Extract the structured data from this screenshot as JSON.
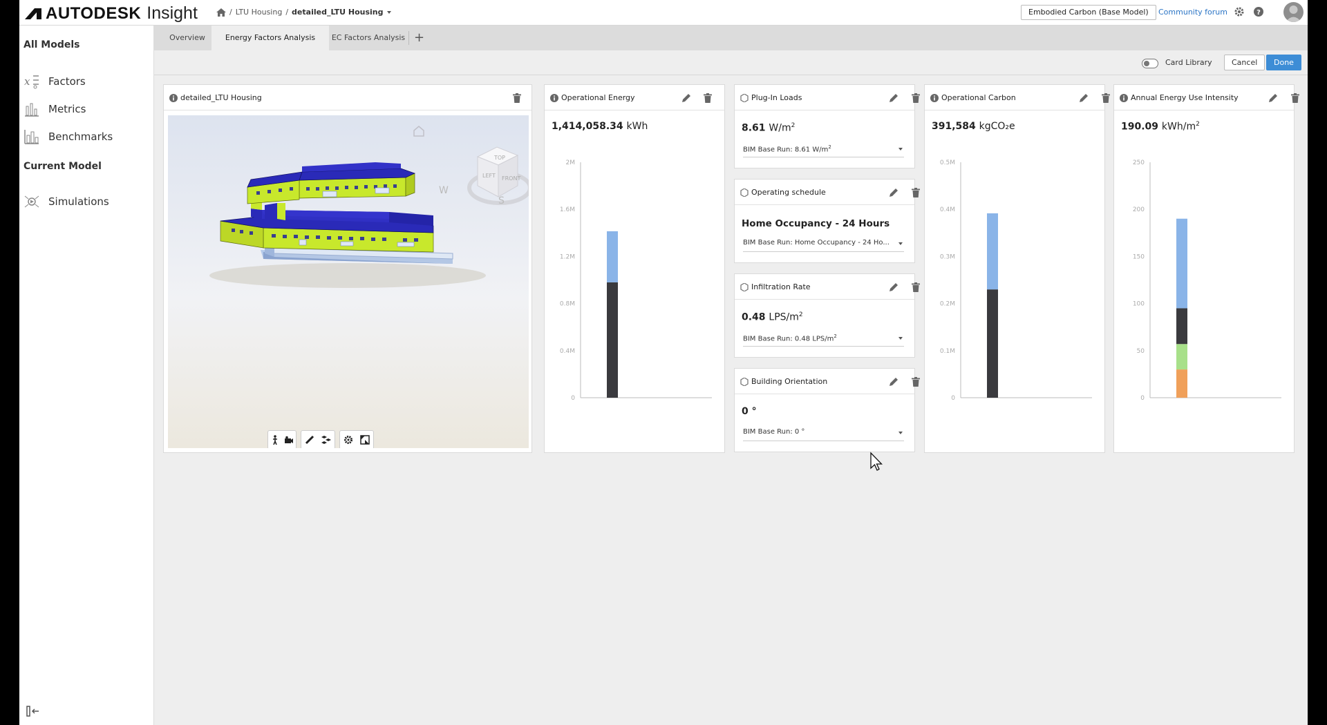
{
  "header": {
    "brand": "AUTODESK",
    "product": "Insight",
    "breadcrumb": [
      "LTU Housing",
      "detailed_LTU Housing"
    ],
    "model_selector": "Embodied Carbon (Base Model)",
    "community_link": "Community forum"
  },
  "sidebar": {
    "all_models_heading": "All Models",
    "items": [
      {
        "label": "Factors",
        "icon": "factors-icon"
      },
      {
        "label": "Metrics",
        "icon": "metrics-icon"
      },
      {
        "label": "Benchmarks",
        "icon": "benchmarks-icon"
      }
    ],
    "current_model_heading": "Current Model",
    "current_items": [
      {
        "label": "Simulations",
        "icon": "simulations-icon"
      }
    ]
  },
  "tabs": [
    {
      "label": "Overview",
      "active": false
    },
    {
      "label": "Energy Factors Analysis",
      "active": true
    },
    {
      "label": "EC Factors Analysis",
      "active": false
    }
  ],
  "toolbar": {
    "card_library_label": "Card Library",
    "card_library_enabled": false,
    "cancel_label": "Cancel",
    "done_label": "Done"
  },
  "cards": {
    "model": {
      "title": "detailed_LTU Housing"
    },
    "operational_energy": {
      "title": "Operational Energy",
      "value": "1,414,058.34",
      "unit": "kWh"
    },
    "plug_in_loads": {
      "title": "Plug-In Loads",
      "value": "8.61",
      "unit": "W/m",
      "unit_sup": "2",
      "dropdown": "BIM Base Run: 8.61 W/m",
      "dropdown_sup": "2"
    },
    "operating_schedule": {
      "title": "Operating schedule",
      "value": "Home Occupancy - 24 Hours",
      "dropdown": "BIM Base Run: Home Occupancy - 24 Ho..."
    },
    "infiltration_rate": {
      "title": "Infiltration Rate",
      "value": "0.48",
      "unit": "LPS/m",
      "unit_sup": "2",
      "dropdown": "BIM Base Run: 0.48 LPS/m",
      "dropdown_sup": "2"
    },
    "building_orientation": {
      "title": "Building Orientation",
      "value": "0 °",
      "dropdown": "BIM Base Run: 0 °"
    },
    "operational_carbon": {
      "title": "Operational Carbon",
      "value": "391,584",
      "unit": "kgCO₂e"
    },
    "annual_eui": {
      "title": "Annual Energy Use Intensity",
      "value": "190.09",
      "unit": "kWh/m",
      "unit_sup": "2"
    }
  },
  "chart_data": [
    {
      "id": "operational_energy",
      "type": "bar",
      "stacked": true,
      "ylim": [
        0,
        2000000
      ],
      "ticks": [
        "0",
        "0.4M",
        "0.8M",
        "1.2M",
        "1.6M",
        "2M"
      ],
      "tick_values": [
        0,
        400000,
        800000,
        1200000,
        1600000,
        2000000
      ],
      "series": [
        {
          "values": [
            980000
          ],
          "color": "#3a3a3e"
        },
        {
          "values": [
            434058
          ],
          "color": "#8ab4e8"
        }
      ]
    },
    {
      "id": "operational_carbon",
      "type": "bar",
      "stacked": true,
      "ylim": [
        0,
        500000
      ],
      "ticks": [
        "0",
        "0.1M",
        "0.2M",
        "0.3M",
        "0.4M",
        "0.5M"
      ],
      "tick_values": [
        0,
        100000,
        200000,
        300000,
        400000,
        500000
      ],
      "series": [
        {
          "values": [
            230000
          ],
          "color": "#3a3a3e"
        },
        {
          "values": [
            161584
          ],
          "color": "#8ab4e8"
        }
      ]
    },
    {
      "id": "annual_eui",
      "type": "bar",
      "stacked": true,
      "ylim": [
        0,
        250
      ],
      "ticks": [
        "0",
        "50",
        "100",
        "150",
        "200",
        "250"
      ],
      "tick_values": [
        0,
        50,
        100,
        150,
        200,
        250
      ],
      "series": [
        {
          "values": [
            30
          ],
          "color": "#f0a05a"
        },
        {
          "values": [
            27
          ],
          "color": "#a8e08a"
        },
        {
          "values": [
            38
          ],
          "color": "#3a3a3e"
        },
        {
          "values": [
            95.09
          ],
          "color": "#8ab4e8"
        }
      ]
    }
  ],
  "colors": {
    "accent": "#3d8dd6",
    "link": "#2a74c5",
    "building_roof": "#2a2ab8",
    "building_wall": "#c8e82c"
  }
}
